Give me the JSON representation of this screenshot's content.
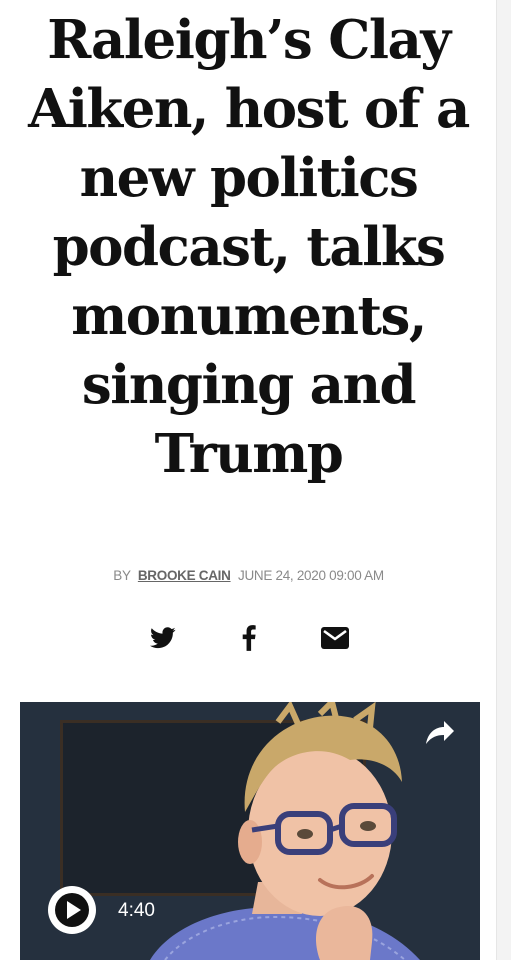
{
  "article": {
    "headline": "Raleigh’s Clay Aiken, host of a new politics podcast, talks monuments, singing and Trump",
    "byline_prefix": "BY",
    "author": "BROOKE CAIN",
    "date": "JUNE 24, 2020 09:00 AM"
  },
  "share": {
    "icons": [
      "twitter-icon",
      "facebook-icon",
      "email-icon"
    ]
  },
  "video": {
    "duration": "4:40",
    "icons": [
      "share-arrow-icon",
      "play-icon"
    ]
  }
}
